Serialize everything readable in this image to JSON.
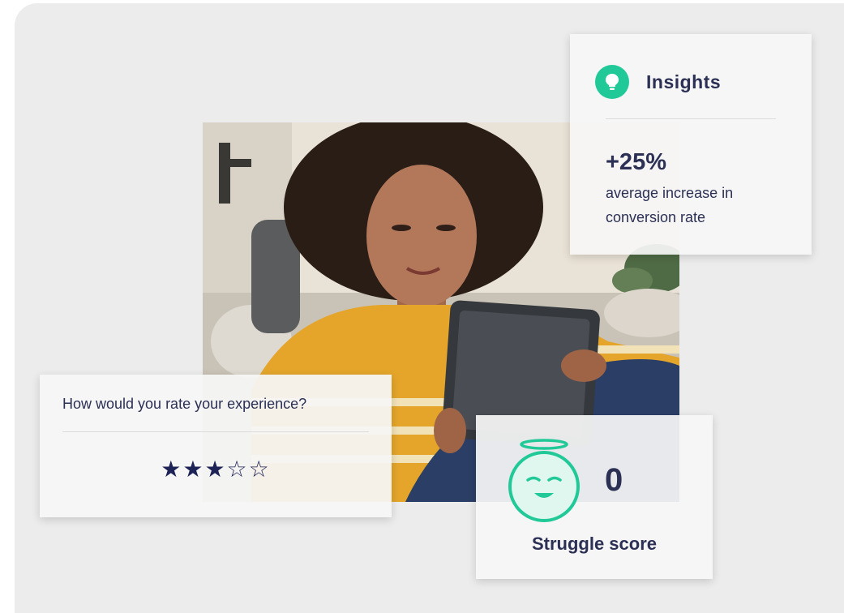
{
  "insights": {
    "title": "Insights",
    "icon": "lightbulb-icon",
    "accent": "#20c997",
    "value": "+25%",
    "description": "average increase in conversion rate"
  },
  "rating": {
    "question": "How would you rate your experience?",
    "stars": "★★★☆☆",
    "filled": 3,
    "total": 5,
    "star_color": "#1d2257"
  },
  "struggle": {
    "value": "0",
    "label": "Struggle score",
    "icon": "happy-halo-face-icon",
    "accent": "#20c997"
  },
  "colors": {
    "text": "#2b3054",
    "background": "#ececec"
  }
}
